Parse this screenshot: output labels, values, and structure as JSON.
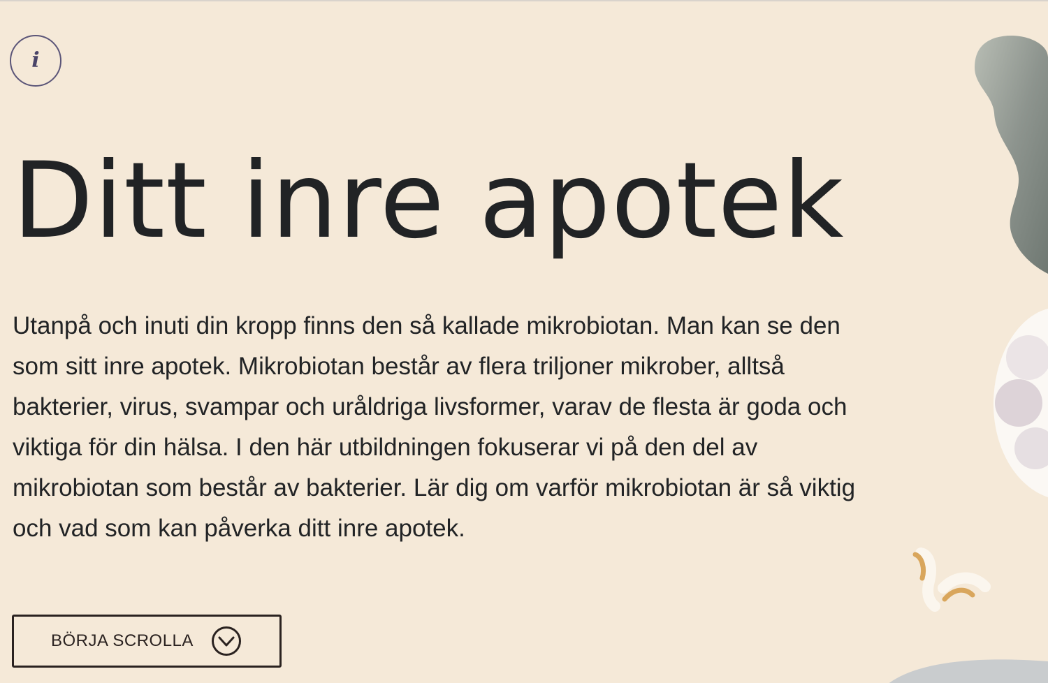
{
  "hero": {
    "info_icon_glyph": "i",
    "title": "Ditt inre apotek",
    "body": "Utanpå och inuti din kropp finns den så kallade mikrobiotan. Man kan se den som sitt inre apotek. Mikrobiotan består av flera triljoner mikrober, alltså bakterier, virus, svampar och uråldriga livsformer, varav de flesta är goda och viktiga för din hälsa. I den här utbildningen fokuserar vi på den del av mikrobiotan som består av bakterier. Lär dig om varför mikrobiotan är så viktig och vad som kan påverka ditt inre apotek.",
    "cta_label": "BÖRJA SCROLLA",
    "cta_icon": "chevron-down-circle-icon"
  },
  "colors": {
    "background": "#f5e9d8",
    "text": "#212325",
    "info_ring": "#5b5578",
    "button_border": "#2a2220",
    "blob_grey": "#8a918c",
    "accent_tan": "#d9a65c"
  }
}
